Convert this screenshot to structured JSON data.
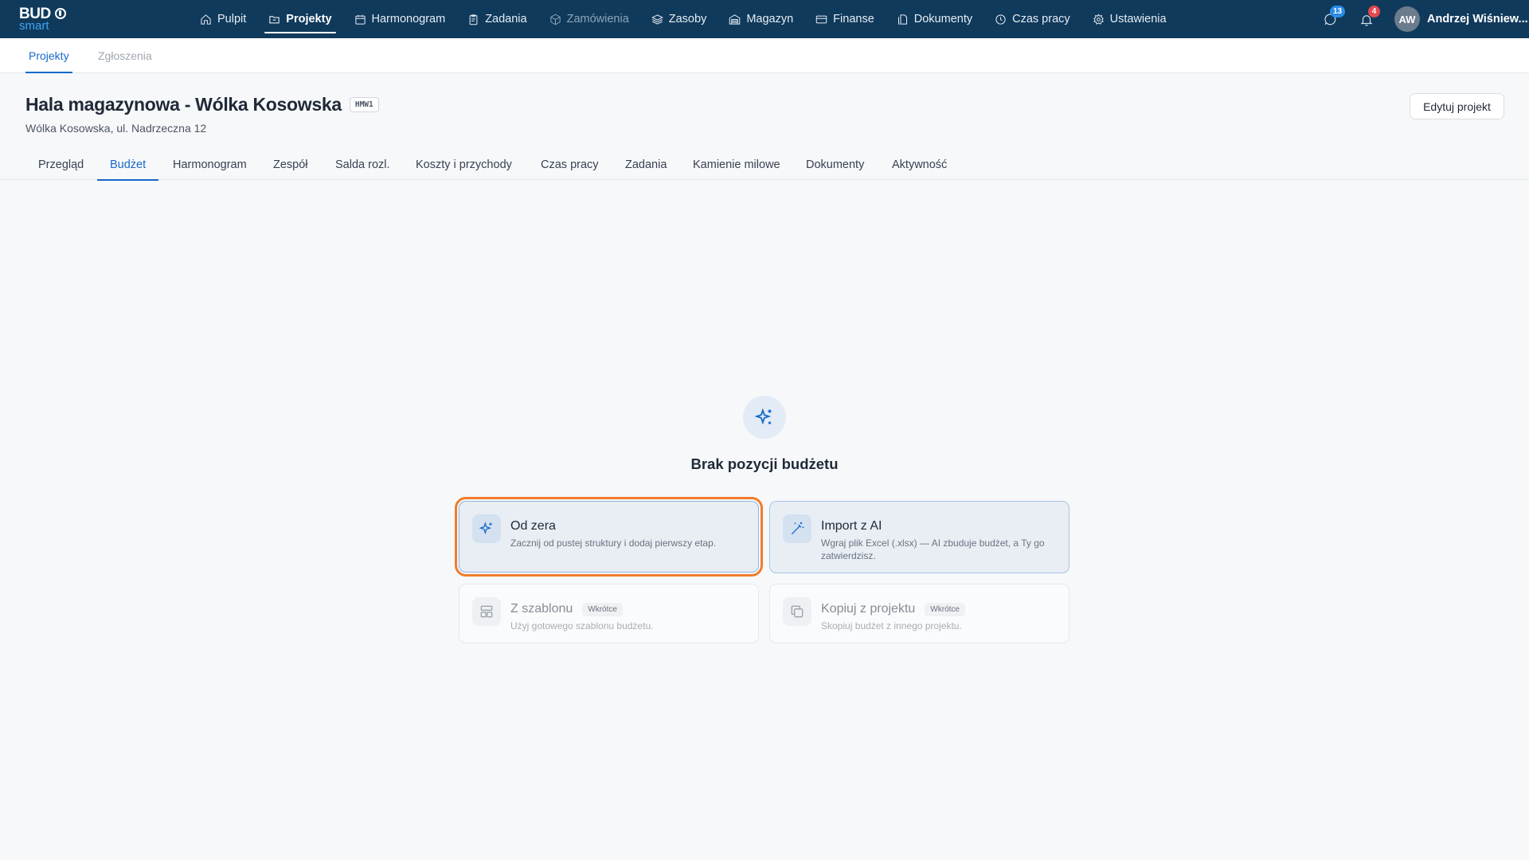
{
  "brand": {
    "line1": "BUD",
    "line2": "smart"
  },
  "nav": {
    "items": [
      {
        "label": "Pulpit",
        "icon": "home-icon"
      },
      {
        "label": "Projekty",
        "icon": "folder-icon",
        "active": true
      },
      {
        "label": "Harmonogram",
        "icon": "calendar-icon"
      },
      {
        "label": "Zadania",
        "icon": "clipboard-icon"
      },
      {
        "label": "Zamówienia",
        "icon": "box-icon",
        "muted": true
      },
      {
        "label": "Zasoby",
        "icon": "layers-icon"
      },
      {
        "label": "Magazyn",
        "icon": "warehouse-icon"
      },
      {
        "label": "Finanse",
        "icon": "credit-card-icon"
      },
      {
        "label": "Dokumenty",
        "icon": "documents-icon"
      },
      {
        "label": "Czas pracy",
        "icon": "clock-icon"
      },
      {
        "label": "Ustawienia",
        "icon": "gear-icon"
      }
    ]
  },
  "topright": {
    "messages_count": "13",
    "notifications_count": "4",
    "avatar_initials": "AW",
    "user_name": "Andrzej Wiśniew..."
  },
  "subnav": {
    "tab1": "Projekty",
    "tab2": "Zgłoszenia"
  },
  "project": {
    "title": "Hala magazynowa - Wólka Kosowska",
    "code": "HMW1",
    "address": "Wólka Kosowska, ul. Nadrzeczna 12",
    "edit_label": "Edytuj projekt"
  },
  "tabs": [
    {
      "label": "Przegląd"
    },
    {
      "label": "Budżet",
      "active": true
    },
    {
      "label": "Harmonogram"
    },
    {
      "label": "Zespół"
    },
    {
      "label": "Salda rozl."
    },
    {
      "label": "Koszty i przychody"
    },
    {
      "label": "Czas pracy"
    },
    {
      "label": "Zadania"
    },
    {
      "label": "Kamienie milowe"
    },
    {
      "label": "Dokumenty"
    },
    {
      "label": "Aktywność"
    }
  ],
  "empty_state": {
    "title": "Brak pozycji budżetu",
    "options": {
      "scratch": {
        "title": "Od zera",
        "desc": "Zacznij od pustej struktury i dodaj pierwszy etap."
      },
      "ai": {
        "title": "Import z AI",
        "desc": "Wgraj plik Excel (.xlsx) — AI zbuduje budżet, a Ty go zatwierdzisz."
      },
      "template": {
        "title": "Z szablonu",
        "badge": "Wkrótce",
        "desc": "Użyj gotowego szablonu budżetu."
      },
      "copy": {
        "title": "Kopiuj z projektu",
        "badge": "Wkrótce",
        "desc": "Skopiuj budżet z innego projektu."
      }
    }
  },
  "colors": {
    "navbar": "#103a5c",
    "accent": "#1769c9",
    "focus_ring": "#ef7d2c"
  }
}
